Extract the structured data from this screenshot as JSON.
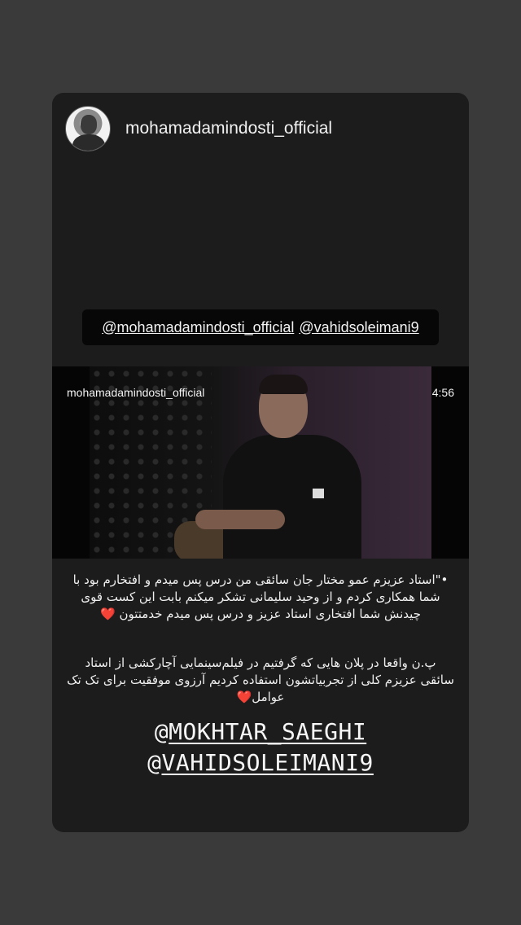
{
  "story": {
    "username": "mohamadamindosti_official",
    "mentions": [
      "@mohamadamindosti_official",
      "@vahidsoleimani9"
    ]
  },
  "video": {
    "username": "mohamadamindosti_official",
    "duration": "4:56"
  },
  "caption1": {
    "lines": [
      "•\"استاد عزیزم عمو مختار جان سائقی من درس پس میدم و افتخارم بود با",
      "شما همکاری کردم و از وحید سلیمانی تشکر میکنم بابت این کست قوی",
      "چیدنش شما افتخاری استاد عزیز و درس پس میدم خدمتتون"
    ],
    "heart": "❤️"
  },
  "caption2": {
    "lines": [
      "پ.ن واقعا در پلان هایی که گرفتیم در فیلم‌سینمایی آچارکشی از استاد",
      "سائقی عزیزم کلی از تجربیاتشون استفاده کردیم آرزوی موفقیت برای تک تک",
      "عوامل"
    ],
    "heart": "❤️"
  },
  "big_mentions": {
    "at": "@",
    "handles": [
      "MOKHTAR_SAEGHI",
      "VAHIDSOLEIMANI9"
    ]
  }
}
